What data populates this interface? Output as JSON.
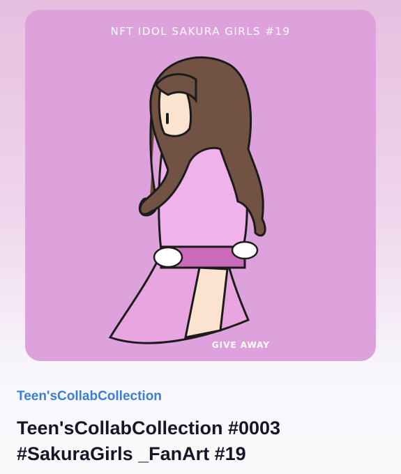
{
  "artwork": {
    "caption": "NFT IDOL SAKURA GIRLS #19",
    "footer": "GIVE AWAY",
    "background_color": "#dda2dc",
    "subject": "illustration of girl with long brown hair in pink dress"
  },
  "collection": {
    "name": "Teen'sCollabCollection",
    "link_color": "#3c7fd2"
  },
  "item": {
    "title_line1": "Teen'sCollabCollection #0003",
    "title_line2": "#SakuraGirls _FanArt #19"
  }
}
